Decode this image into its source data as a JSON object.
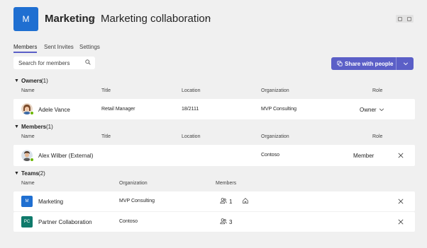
{
  "header": {
    "team_initial": "M",
    "team_name": "Marketing",
    "separator": ">",
    "channel_name": "Marketing collaboration",
    "more": "···"
  },
  "tabs": [
    {
      "label": "Members",
      "active": true
    },
    {
      "label": "Sent Invites",
      "active": false
    },
    {
      "label": "Settings",
      "active": false
    }
  ],
  "search": {
    "placeholder": "Search for members"
  },
  "share_button": {
    "label": "Share with people"
  },
  "columns_people": {
    "name": "Name",
    "title": "Title",
    "location": "Location",
    "organization": "Organization",
    "role": "Role"
  },
  "columns_teams": {
    "name": "Name",
    "organization": "Organization",
    "members": "Members"
  },
  "owners": {
    "label": "Owners",
    "count": "(1)",
    "rows": [
      {
        "name": "Adele Vance",
        "title": "Retail Manager",
        "location": "18/2111",
        "organization": "MVP Consulting",
        "role": "Owner"
      }
    ]
  },
  "members": {
    "label": "Members",
    "count": "(1)",
    "rows": [
      {
        "name": "Alex Wilber (External)",
        "title": "",
        "location": "",
        "organization": "Contoso",
        "role": "Member"
      }
    ]
  },
  "teams": {
    "label": "Teams",
    "count": "(2)",
    "rows": [
      {
        "initials": "M",
        "name": "Marketing",
        "organization": "MVP Consulting",
        "members": "1",
        "color": "#1f6fd1"
      },
      {
        "initials": "PC",
        "name": "Partner Collaboration",
        "organization": "Contoso",
        "members": "3",
        "color": "#0f7a6b"
      }
    ]
  },
  "colors": {
    "accent": "#5b5fc7",
    "presence": "#6bb700"
  }
}
